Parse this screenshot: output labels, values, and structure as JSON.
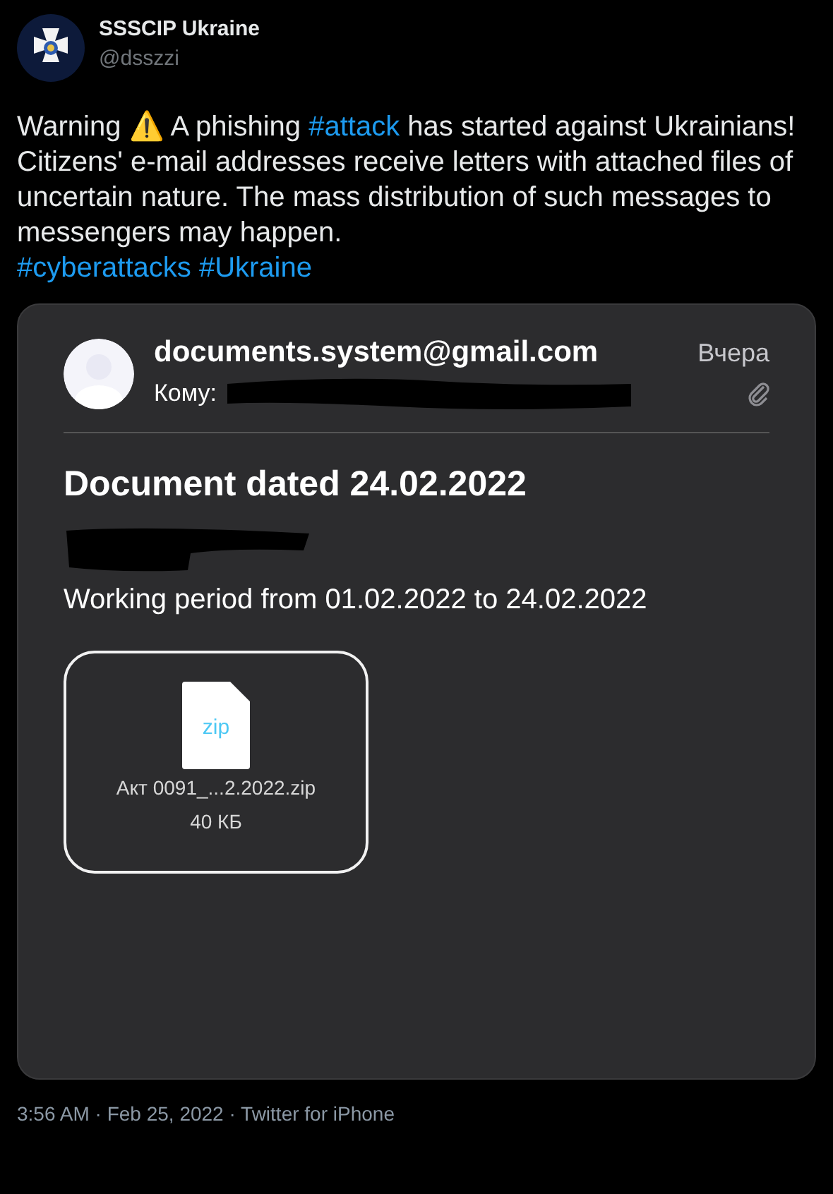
{
  "author": {
    "name": "SSSCIP Ukraine",
    "handle": "@dsszzi"
  },
  "body": [
    {
      "kind": "text",
      "text": "Warning ⚠️ A phishing "
    },
    {
      "kind": "hashtag",
      "text": "#attack"
    },
    {
      "kind": "text",
      "text": " has started against Ukrainians! Citizens' e-mail addresses receive letters with attached files of uncertain nature. The mass distribution of such messages to messengers may happen."
    }
  ],
  "hashtags": [
    "#cyberattacks",
    "#Ukraine"
  ],
  "email": {
    "sender": "documents.system@gmail.com",
    "to_label": "Кому:",
    "date": "Вчера",
    "subject": "Document dated 24.02.2022",
    "message": "Working period from 01.02.2022 to 24.02.2022",
    "attachment": {
      "type": "zip",
      "name": "Акт 0091_...2.2022.zip",
      "size": "40 КБ"
    }
  },
  "footer": {
    "time": "3:56 AM",
    "date": "Feb 25, 2022",
    "source": "Twitter for iPhone",
    "separator": "·"
  }
}
